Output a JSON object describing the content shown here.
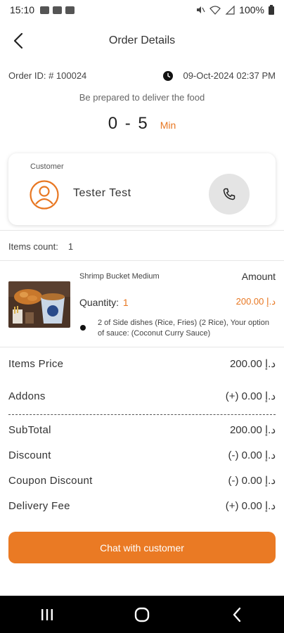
{
  "status_bar": {
    "time": "15:10",
    "battery": "100%",
    "icons": [
      "gallery-icon",
      "screen-record-icon",
      "youtube-icon",
      "mute-icon",
      "wifi-icon",
      "signal-icon",
      "battery-icon"
    ]
  },
  "header": {
    "title": "Order Details",
    "back_icon": "chevron-left-icon"
  },
  "order": {
    "id_label": "Order ID: # 100024",
    "date": "09-Oct-2024 02:37 PM",
    "prep_text": "Be prepared to deliver the food",
    "time_range": "0 - 5",
    "time_unit": "Min"
  },
  "customer": {
    "label": "Customer",
    "name": "Tester Test",
    "call_icon": "phone-icon"
  },
  "items_count": {
    "label": "Items count:",
    "value": "1"
  },
  "items": [
    {
      "name": "Shrimp Bucket Medium",
      "amount_label": "Amount",
      "quantity_label": "Quantity:",
      "quantity": "1",
      "price": "200.00 د.إ",
      "addons": "2 of Side dishes (Rice, Fries) (2 Rice), Your option of sauce: (Coconut Curry Sauce)"
    }
  ],
  "summary": {
    "items_price_label": "Items Price",
    "items_price": "200.00 د.إ",
    "addons_label": "Addons",
    "addons": "(+) 0.00 د.إ",
    "subtotal_label": "SubTotal",
    "subtotal": "200.00 د.إ",
    "discount_label": "Discount",
    "discount": "(-) 0.00 د.إ",
    "coupon_label": "Coupon Discount",
    "coupon": "(-) 0.00 د.إ",
    "delivery_label": "Delivery Fee",
    "delivery": "(+) 0.00 د.إ"
  },
  "actions": {
    "chat_label": "Chat with customer"
  },
  "colors": {
    "accent": "#ea7a24",
    "nav_bg": "#000000"
  }
}
